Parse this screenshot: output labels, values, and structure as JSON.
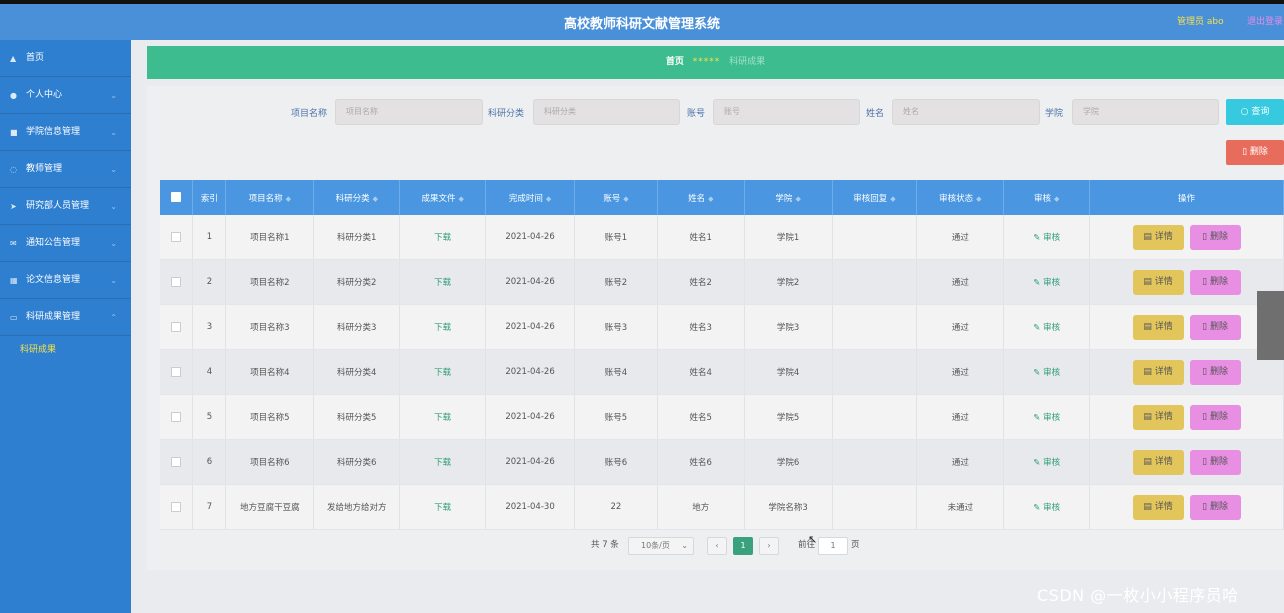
{
  "header": {
    "title": "高校教师科研文献管理系统",
    "admin_label": "管理员 abo",
    "logout_label": "退出登录"
  },
  "sidebar": {
    "items": [
      {
        "label": "首页",
        "icon": "home-icon"
      },
      {
        "label": "个人中心",
        "icon": "user-icon"
      },
      {
        "label": "学院信息管理",
        "icon": "folder-icon"
      },
      {
        "label": "教师管理",
        "icon": "power-icon"
      },
      {
        "label": "研究部人员管理",
        "icon": "send-icon"
      },
      {
        "label": "通知公告管理",
        "icon": "mail-icon"
      },
      {
        "label": "论文信息管理",
        "icon": "grid-icon"
      },
      {
        "label": "科研成果管理",
        "icon": "doc-icon"
      }
    ],
    "sub_item": "科研成果"
  },
  "breadcrumb": {
    "home": "首页",
    "separator": "*****",
    "current": "科研成果"
  },
  "filters": {
    "project_label": "项目名称",
    "project_placeholder": "项目名称",
    "category_label": "科研分类",
    "category_placeholder": "科研分类",
    "account_label": "账号",
    "account_placeholder": "账号",
    "name_label": "姓名",
    "name_placeholder": "姓名",
    "college_label": "学院",
    "college_placeholder": "学院",
    "search_button": "查询",
    "delete_button": "删除"
  },
  "table": {
    "headers": [
      "索引",
      "项目名称",
      "科研分类",
      "成果文件",
      "完成时间",
      "账号",
      "姓名",
      "学院",
      "审核回复",
      "审核状态",
      "审核",
      "操作"
    ],
    "rows": [
      {
        "index": "1",
        "project": "项目名称1",
        "category": "科研分类1",
        "file": "下载",
        "date": "2021-04-26",
        "account": "账号1",
        "name": "姓名1",
        "college": "学院1",
        "reply": "",
        "status": "通过",
        "audit": "审核",
        "detail": "详情",
        "delete": "删除"
      },
      {
        "index": "2",
        "project": "项目名称2",
        "category": "科研分类2",
        "file": "下载",
        "date": "2021-04-26",
        "account": "账号2",
        "name": "姓名2",
        "college": "学院2",
        "reply": "",
        "status": "通过",
        "audit": "审核",
        "detail": "详情",
        "delete": "删除"
      },
      {
        "index": "3",
        "project": "项目名称3",
        "category": "科研分类3",
        "file": "下载",
        "date": "2021-04-26",
        "account": "账号3",
        "name": "姓名3",
        "college": "学院3",
        "reply": "",
        "status": "通过",
        "audit": "审核",
        "detail": "详情",
        "delete": "删除"
      },
      {
        "index": "4",
        "project": "项目名称4",
        "category": "科研分类4",
        "file": "下载",
        "date": "2021-04-26",
        "account": "账号4",
        "name": "姓名4",
        "college": "学院4",
        "reply": "",
        "status": "通过",
        "audit": "审核",
        "detail": "详情",
        "delete": "删除"
      },
      {
        "index": "5",
        "project": "项目名称5",
        "category": "科研分类5",
        "file": "下载",
        "date": "2021-04-26",
        "account": "账号5",
        "name": "姓名5",
        "college": "学院5",
        "reply": "",
        "status": "通过",
        "audit": "审核",
        "detail": "详情",
        "delete": "删除"
      },
      {
        "index": "6",
        "project": "项目名称6",
        "category": "科研分类6",
        "file": "下载",
        "date": "2021-04-26",
        "account": "账号6",
        "name": "姓名6",
        "college": "学院6",
        "reply": "",
        "status": "通过",
        "audit": "审核",
        "detail": "详情",
        "delete": "删除"
      },
      {
        "index": "7",
        "project": "地方豆腐干豆腐",
        "category": "发给地方给对方",
        "file": "下载",
        "date": "2021-04-30",
        "account": "22",
        "name": "地方",
        "college": "学院名称3",
        "reply": "",
        "status": "未通过",
        "audit": "审核",
        "detail": "详情",
        "delete": "删除"
      }
    ]
  },
  "pagination": {
    "total": "共 7 条",
    "page_size": "10条/页",
    "current_page": "1",
    "goto_label": "前往",
    "goto_value": "1",
    "page_unit": "页"
  },
  "watermark": "CSDN @一枚小小程序员哈"
}
